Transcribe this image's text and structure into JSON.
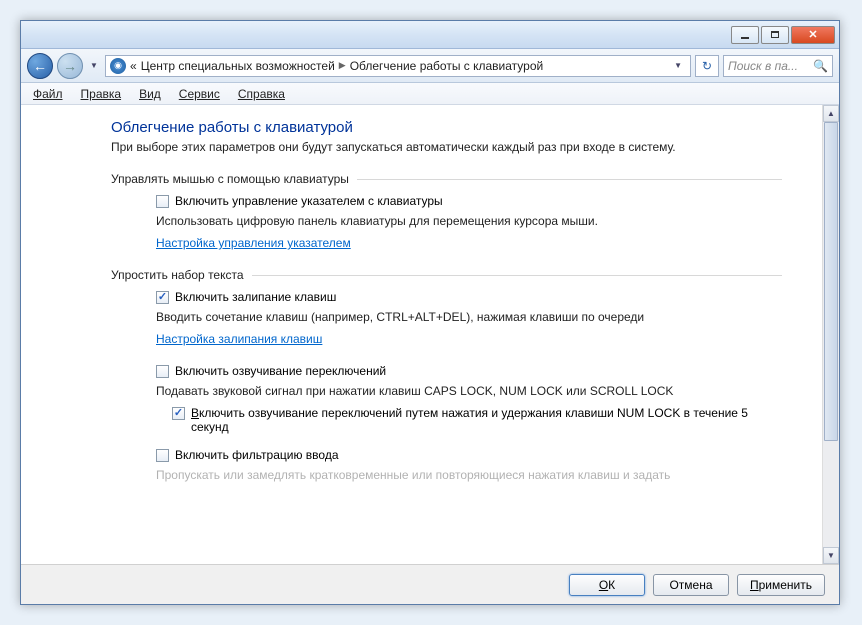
{
  "breadcrumb": {
    "prefix": "«",
    "item1": "Центр специальных возможностей",
    "item2": "Облегчение работы с клавиатурой"
  },
  "search": {
    "placeholder": "Поиск в па..."
  },
  "menu": {
    "file": "Файл",
    "edit": "Правка",
    "view": "Вид",
    "service": "Сервис",
    "help": "Справка"
  },
  "page": {
    "title": "Облегчение работы с клавиатурой",
    "subtitle": "При выборе этих параметров они будут запускаться автоматически каждый раз при входе в систему."
  },
  "section1": {
    "head": "Управлять мышью с помощью клавиатуры",
    "chk1": "Включить управление указателем с клавиатуры",
    "chk1_checked": false,
    "desc1": "Использовать цифровую панель клавиатуры для перемещения курсора мыши.",
    "link1": "Настройка управления указателем"
  },
  "section2": {
    "head": "Упростить набор текста",
    "chk1": "Включить залипание клавиш",
    "chk1_checked": true,
    "desc1": "Вводить сочетание клавиш (например, CTRL+ALT+DEL), нажимая клавиши по очереди",
    "link1": "Настройка залипания клавиш",
    "chk2": "Включить озвучивание переключений",
    "chk2_checked": false,
    "desc2": "Подавать звуковой сигнал при нажатии клавиш CAPS LOCK, NUM LOCK или SCROLL LOCK",
    "chk3_pre": "В",
    "chk3_rest": "ключить озвучивание переключений путем нажатия и удержания клавиши NUM LOCK в течение 5 секунд",
    "chk3_checked": true,
    "chk4": "Включить фильтрацию ввода",
    "chk4_checked": false,
    "desc4_partial": "Пропускать или замедлять кратковременные или повторяющиеся нажатия клавиш и задать"
  },
  "buttons": {
    "ok_pre": "О",
    "ok_rest": "К",
    "cancel": "Отмена",
    "apply_pre": "П",
    "apply_rest": "рименить"
  }
}
